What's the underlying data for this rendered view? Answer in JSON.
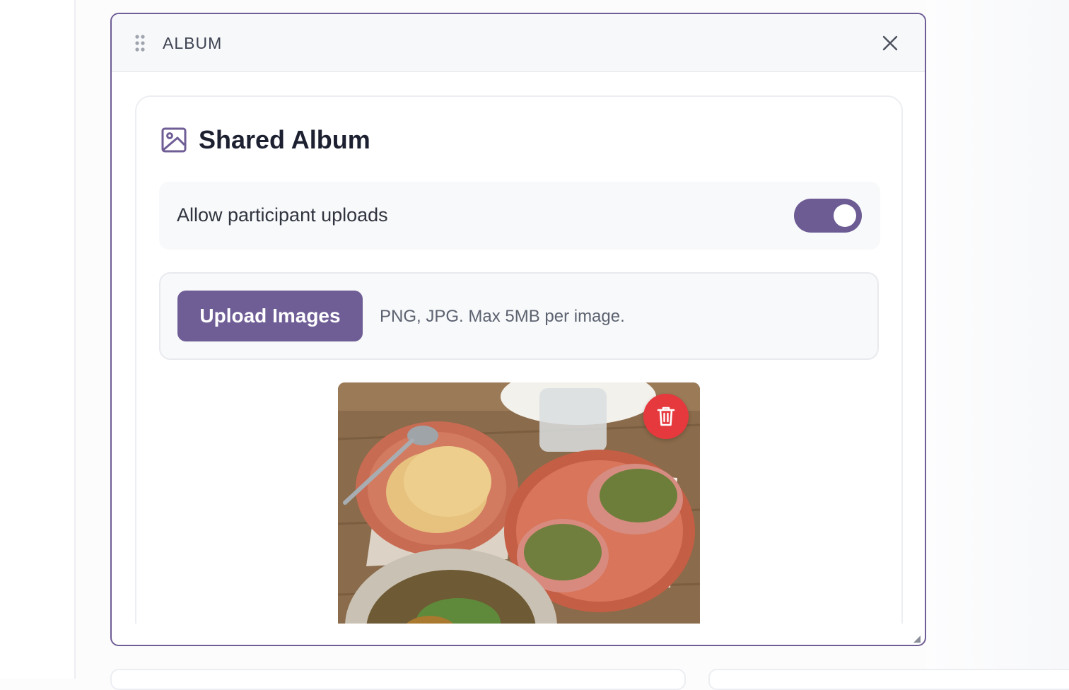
{
  "widget": {
    "title": "ALBUM",
    "close_icon": "close-icon",
    "drag_icon": "drag-handle-icon"
  },
  "album": {
    "title": "Shared Album",
    "icon": "image-icon",
    "allow_uploads_label": "Allow participant uploads",
    "allow_uploads_enabled": true,
    "upload_button_label": "Upload Images",
    "upload_hint": "PNG, JPG. Max 5MB per image.",
    "photos": [
      {
        "alt": "Food on plates",
        "delete_icon": "trash-icon"
      }
    ]
  },
  "colors": {
    "accent": "#6f5d96",
    "delete": "#e5393d",
    "border_active": "#6f5d95"
  }
}
